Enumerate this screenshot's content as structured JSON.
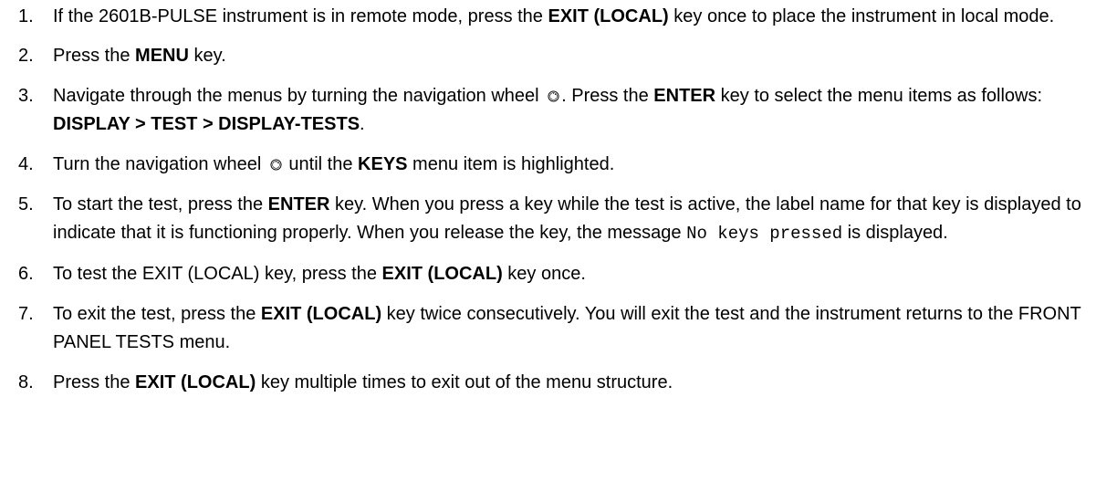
{
  "steps": [
    {
      "num": "1.",
      "parts": [
        {
          "t": "If the 2601B-PULSE instrument is in remote mode, press the "
        },
        {
          "t": "EXIT (LOCAL)",
          "s": "b"
        },
        {
          "t": " key once to place the instrument in local mode."
        }
      ]
    },
    {
      "num": "2.",
      "parts": [
        {
          "t": "Press the "
        },
        {
          "t": "MENU",
          "s": "b"
        },
        {
          "t": " key."
        }
      ]
    },
    {
      "num": "3.",
      "parts": [
        {
          "t": "Navigate through the menus by turning the navigation wheel "
        },
        {
          "icon": "navigation-wheel-icon"
        },
        {
          "t": ". Press the "
        },
        {
          "t": "ENTER",
          "s": "b"
        },
        {
          "t": " key to select the menu items as follows: "
        },
        {
          "t": "DISPLAY > TEST > DISPLAY-TESTS",
          "s": "b"
        },
        {
          "t": "."
        }
      ]
    },
    {
      "num": "4.",
      "parts": [
        {
          "t": "Turn the navigation wheel "
        },
        {
          "icon": "navigation-wheel-icon"
        },
        {
          "t": " until the "
        },
        {
          "t": "KEYS",
          "s": "b"
        },
        {
          "t": " menu item is highlighted."
        }
      ]
    },
    {
      "num": "5.",
      "parts": [
        {
          "t": "To start the test, press the "
        },
        {
          "t": "ENTER",
          "s": "b"
        },
        {
          "t": " key. When you press a key while the test is active, the label name for that key is displayed to indicate that it is functioning properly. When you release the key, the message "
        },
        {
          "t": "No keys pressed",
          "s": "mono"
        },
        {
          "t": " is displayed."
        }
      ]
    },
    {
      "num": "6.",
      "parts": [
        {
          "t": "To test the EXIT (LOCAL) key, press the "
        },
        {
          "t": "EXIT (LOCAL)",
          "s": "b"
        },
        {
          "t": " key once."
        }
      ]
    },
    {
      "num": "7.",
      "parts": [
        {
          "t": "To exit the test, press the "
        },
        {
          "t": "EXIT (LOCAL)",
          "s": "b"
        },
        {
          "t": " key twice consecutively. You will exit the test and the instrument returns to the FRONT PANEL TESTS menu."
        }
      ]
    },
    {
      "num": "8.",
      "parts": [
        {
          "t": "Press the "
        },
        {
          "t": "EXIT (LOCAL)",
          "s": "b"
        },
        {
          "t": " key multiple times to exit out of the menu structure."
        }
      ]
    }
  ]
}
